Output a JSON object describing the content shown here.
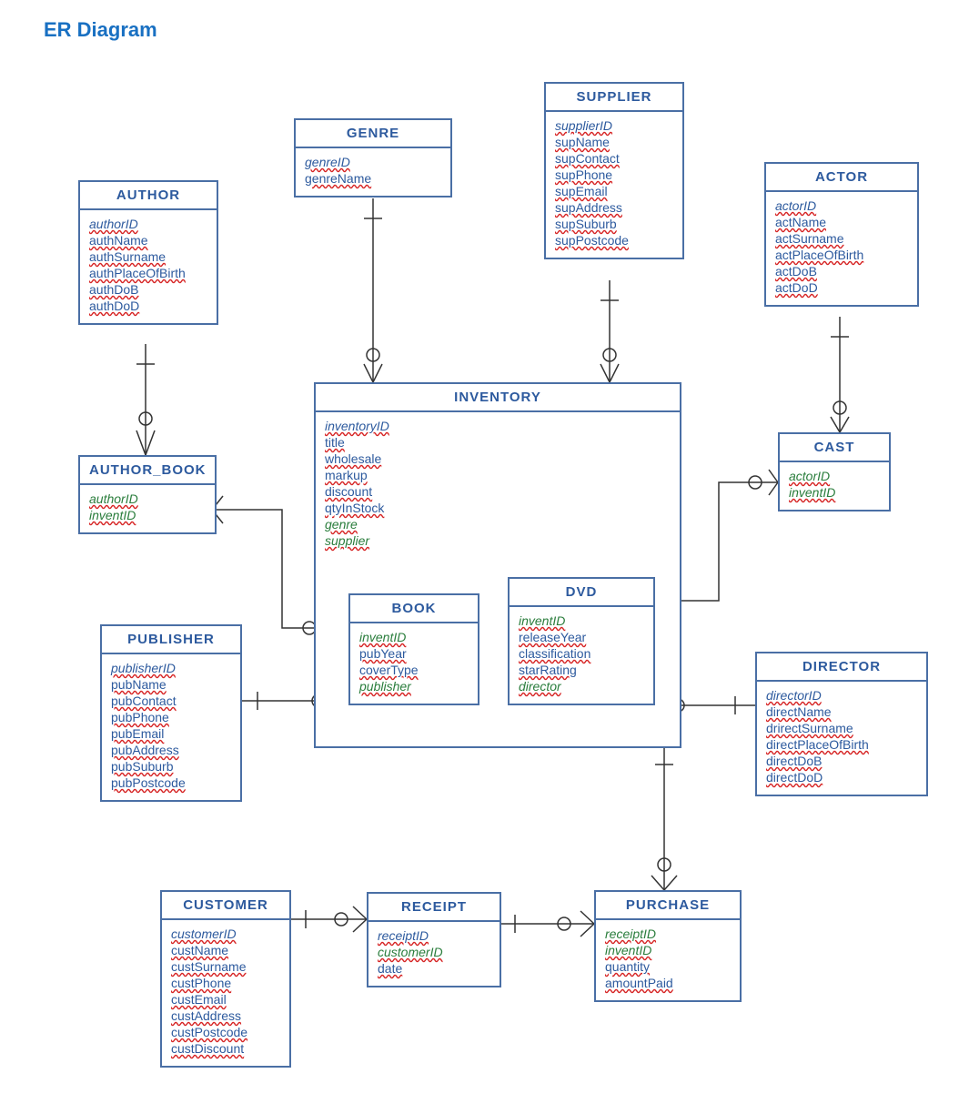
{
  "title": "ER Diagram",
  "entities": {
    "author": {
      "name": "AUTHOR",
      "attrs": [
        "authorID",
        "authName",
        "authSurname",
        "authPlaceOfBirth",
        "authDoB",
        "authDoD"
      ],
      "pk": [
        "authorID"
      ]
    },
    "genre": {
      "name": "GENRE",
      "attrs": [
        "genreID",
        "genreName"
      ],
      "pk": [
        "genreID"
      ]
    },
    "supplier": {
      "name": "SUPPLIER",
      "attrs": [
        "supplierID",
        "supName",
        "supContact",
        "supPhone",
        "supEmail",
        "supAddress",
        "supSuburb",
        "supPostcode"
      ],
      "pk": [
        "supplierID"
      ]
    },
    "actor": {
      "name": "ACTOR",
      "attrs": [
        "actorID",
        "actName",
        "actSurname",
        "actPlaceOfBirth",
        "actDoB",
        "actDoD"
      ],
      "pk": [
        "actorID"
      ]
    },
    "author_book": {
      "name": "AUTHOR_BOOK",
      "attrs": [
        "authorID",
        "inventID"
      ],
      "pk": [
        "authorID",
        "inventID"
      ],
      "fk": [
        "authorID",
        "inventID"
      ]
    },
    "inventory": {
      "name": "INVENTORY",
      "attrs": [
        "inventoryID",
        "title",
        "wholesale",
        "markup",
        "discount",
        "qtyInStock",
        "genre",
        "supplier"
      ],
      "pk": [
        "inventoryID"
      ],
      "fk": [
        "genre",
        "supplier"
      ]
    },
    "cast": {
      "name": "CAST",
      "attrs": [
        "actorID",
        "inventID"
      ],
      "pk": [
        "actorID",
        "inventID"
      ],
      "fk": [
        "actorID",
        "inventID"
      ]
    },
    "book": {
      "name": "BOOK",
      "attrs": [
        "inventID",
        "pubYear",
        "coverType",
        "publisher"
      ],
      "pk": [
        "inventID"
      ],
      "fk": [
        "inventID",
        "publisher"
      ]
    },
    "dvd": {
      "name": "DVD",
      "attrs": [
        "inventID",
        "releaseYear",
        "classification",
        "starRating",
        "director"
      ],
      "pk": [
        "inventID"
      ],
      "fk": [
        "inventID",
        "director"
      ]
    },
    "publisher": {
      "name": "PUBLISHER",
      "attrs": [
        "publisherID",
        "pubName",
        "pubContact",
        "pubPhone",
        "pubEmail",
        "pubAddress",
        "pubSuburb",
        "pubPostcode"
      ],
      "pk": [
        "publisherID"
      ]
    },
    "director": {
      "name": "DIRECTOR",
      "attrs": [
        "directorID",
        "directName",
        "drirectSurname",
        "directPlaceOfBirth",
        "directDoB",
        "directDoD"
      ],
      "pk": [
        "directorID"
      ]
    },
    "customer": {
      "name": "CUSTOMER",
      "attrs": [
        "customerID",
        "custName",
        "custSurname",
        "custPhone",
        "custEmail",
        "custAddress",
        "custPostcode",
        "custDiscount"
      ],
      "pk": [
        "customerID"
      ]
    },
    "receipt": {
      "name": "RECEIPT",
      "attrs": [
        "receiptID",
        "customerID",
        "date"
      ],
      "pk": [
        "receiptID"
      ],
      "fk": [
        "customerID"
      ]
    },
    "purchase": {
      "name": "PURCHASE",
      "attrs": [
        "receiptID",
        "inventID",
        "quantity",
        "amountPaid"
      ],
      "pk": [
        "receiptID",
        "inventID"
      ],
      "fk": [
        "receiptID",
        "inventID"
      ]
    }
  },
  "relationships": [
    {
      "from": "author",
      "to": "author_book",
      "card": "one-many"
    },
    {
      "from": "author_book",
      "to": "inventory",
      "card": "many-one"
    },
    {
      "from": "genre",
      "to": "inventory",
      "card": "one-many"
    },
    {
      "from": "supplier",
      "to": "inventory",
      "card": "one-many"
    },
    {
      "from": "actor",
      "to": "cast",
      "card": "one-many"
    },
    {
      "from": "cast",
      "to": "dvd",
      "card": "many-one"
    },
    {
      "from": "inventory",
      "to": "book",
      "card": "parent-child"
    },
    {
      "from": "inventory",
      "to": "dvd",
      "card": "parent-child"
    },
    {
      "from": "publisher",
      "to": "book",
      "card": "one-many"
    },
    {
      "from": "director",
      "to": "dvd",
      "card": "one-many"
    },
    {
      "from": "customer",
      "to": "receipt",
      "card": "one-many"
    },
    {
      "from": "receipt",
      "to": "purchase",
      "card": "one-many"
    },
    {
      "from": "purchase",
      "to": "inventory",
      "card": "many-one"
    }
  ]
}
